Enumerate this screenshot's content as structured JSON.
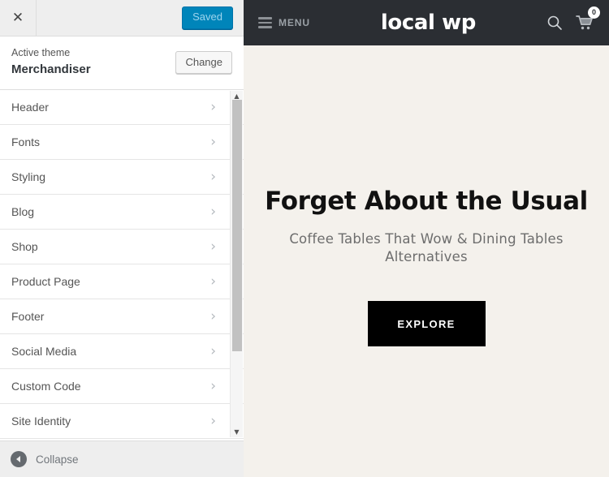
{
  "customizer": {
    "close_label": "✕",
    "save_label": "Saved",
    "theme": {
      "active_label": "Active theme",
      "name": "Merchandiser",
      "change_label": "Change"
    },
    "panels": [
      {
        "label": "Header",
        "chevron": "›"
      },
      {
        "label": "Fonts",
        "chevron": "›"
      },
      {
        "label": "Styling",
        "chevron": "›"
      },
      {
        "label": "Blog",
        "chevron": "›"
      },
      {
        "label": "Shop",
        "chevron": "›"
      },
      {
        "label": "Product Page",
        "chevron": "›"
      },
      {
        "label": "Footer",
        "chevron": "›"
      },
      {
        "label": "Social Media",
        "chevron": "›"
      },
      {
        "label": "Custom Code",
        "chevron": "›"
      },
      {
        "label": "Site Identity",
        "chevron": "›"
      }
    ],
    "scrollbar": {
      "up_arrow": "▲",
      "down_arrow": "▼"
    },
    "collapse_label": "Collapse",
    "colors": {
      "save_button": "#0085ba",
      "sidebar_chrome": "#eeeeee",
      "panel_background": "#ffffff"
    }
  },
  "preview": {
    "header": {
      "menu_label": "MENU",
      "brand": "local wp",
      "cart_count": "0",
      "background": "#2b2e33"
    },
    "hero": {
      "title": "Forget About the Usual",
      "subtitle": "Coffee Tables That Wow & Dining Tables Alternatives",
      "cta_label": "EXPLORE",
      "background": "#f4f1ec",
      "cta_background": "#000000"
    }
  }
}
